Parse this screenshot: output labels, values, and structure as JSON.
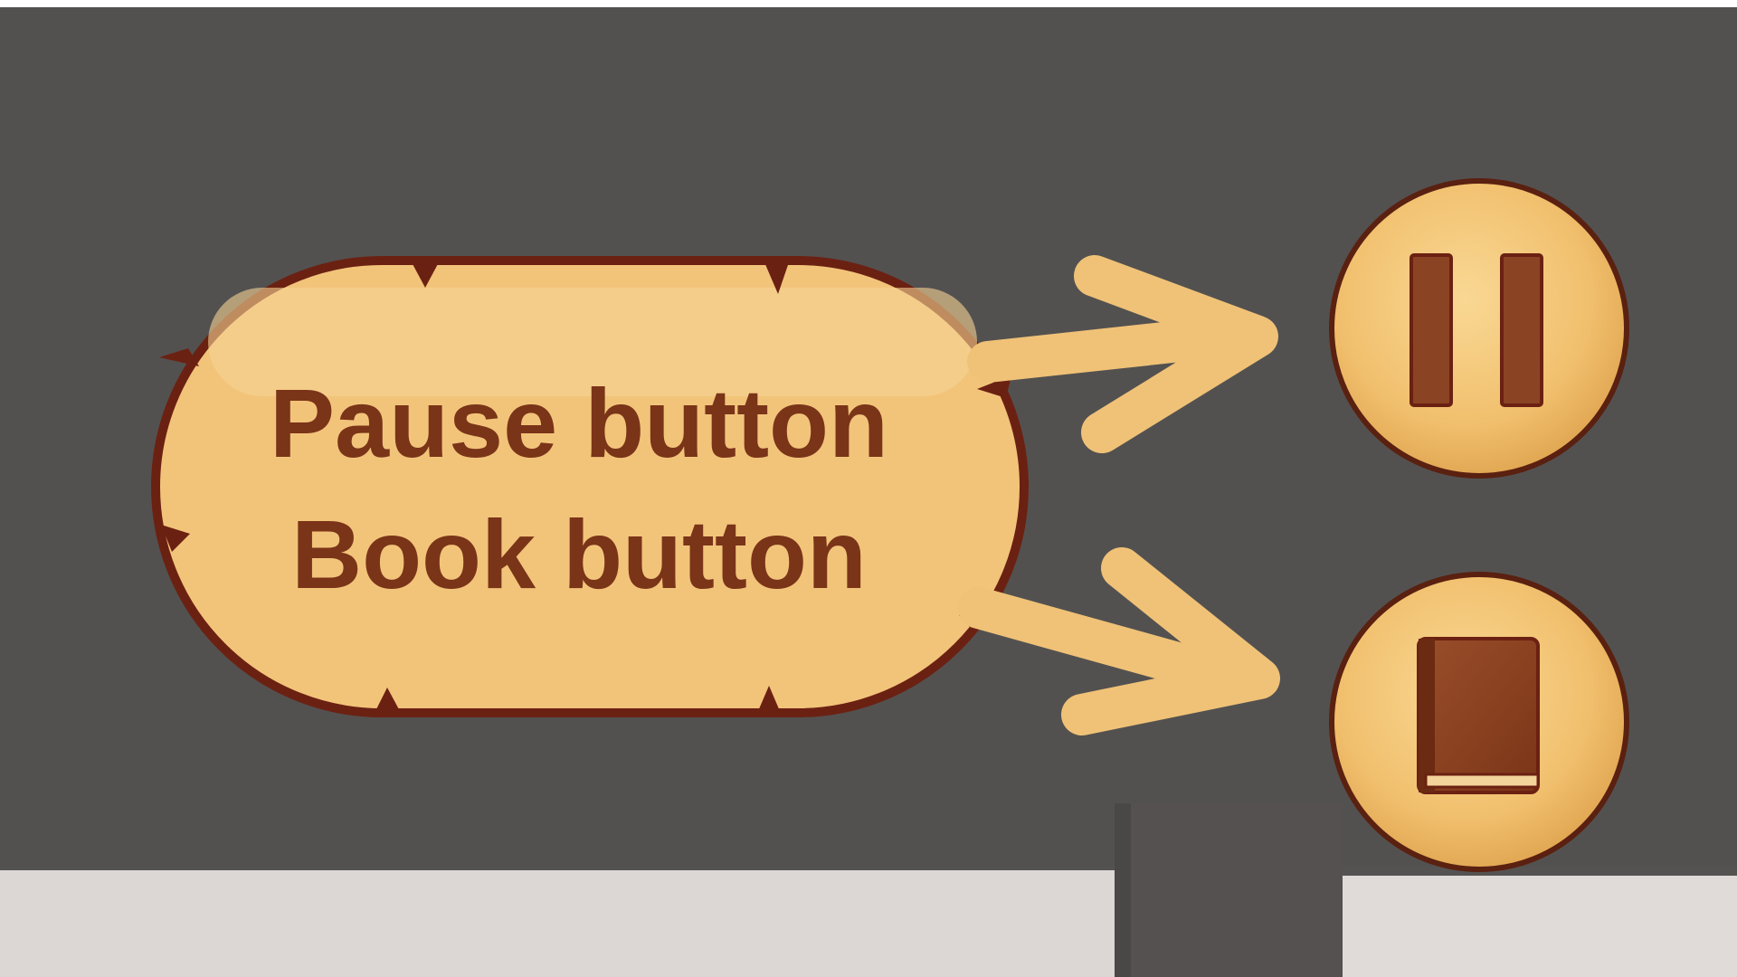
{
  "callout": {
    "line1": "Pause button",
    "line2": "Book button"
  },
  "buttons": [
    {
      "name": "pause",
      "icon": "pause-icon"
    },
    {
      "name": "book",
      "icon": "book-icon"
    }
  ],
  "colors": {
    "background": "#545252",
    "parchment": "#f2c47a",
    "parchment_light": "#f7d495",
    "outline": "#6b2112",
    "text": "#7a3418",
    "arrow": "#f0c277",
    "icon": "#8a4424",
    "floor": "#ddd8d6"
  }
}
